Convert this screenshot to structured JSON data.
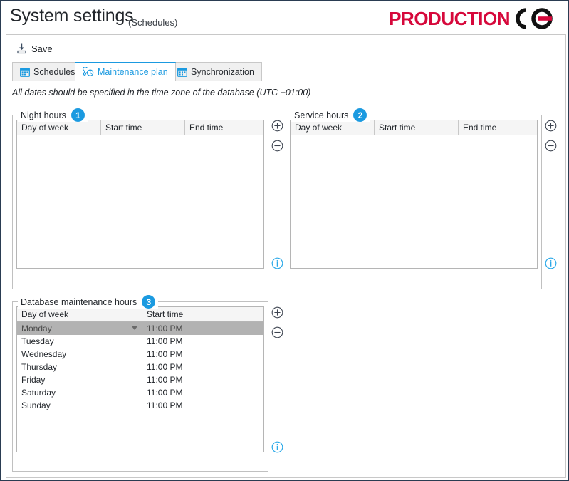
{
  "window": {
    "title": "System settings",
    "subtitle": "(Schedules)",
    "accent_blue": "#1b9ae0",
    "brand_red": "#d6083b",
    "frame_color": "#2a3c52"
  },
  "logo": {
    "text": "PRODUCTION",
    "mark_name": "interlocking-rings-logo-icon"
  },
  "toolbar": {
    "save_label": "Save",
    "save_icon": "save-icon"
  },
  "tabs": [
    {
      "label": "Schedules",
      "icon": "calendar-icon",
      "active": false
    },
    {
      "label": "Maintenance plan",
      "icon": "wrench-clock-icon",
      "active": true
    },
    {
      "label": "Synchronization",
      "icon": "calendar-icon",
      "active": false
    }
  ],
  "note": "All dates should be specified in the time zone of the database (UTC +01:00)",
  "sections": {
    "night_hours": {
      "label": "Night hours",
      "badge": "1",
      "columns": [
        "Day of week",
        "Start time",
        "End time"
      ],
      "rows": []
    },
    "service_hours": {
      "label": "Service hours",
      "badge": "2",
      "columns": [
        "Day of week",
        "Start time",
        "End time"
      ],
      "rows": []
    },
    "database_maintenance_hours": {
      "label": "Database maintenance hours",
      "badge": "3",
      "columns": [
        "Day of week",
        "Start time"
      ],
      "rows": [
        {
          "day": "Monday",
          "start": "11:00 PM",
          "selected": true
        },
        {
          "day": "Tuesday",
          "start": "11:00 PM",
          "selected": false
        },
        {
          "day": "Wednesday",
          "start": "11:00 PM",
          "selected": false
        },
        {
          "day": "Thursday",
          "start": "11:00 PM",
          "selected": false
        },
        {
          "day": "Friday",
          "start": "11:00 PM",
          "selected": false
        },
        {
          "day": "Saturday",
          "start": "11:00 PM",
          "selected": false
        },
        {
          "day": "Sunday",
          "start": "11:00 PM",
          "selected": false
        }
      ]
    }
  },
  "actions": {
    "add_icon": "circle-plus-icon",
    "remove_icon": "circle-minus-icon",
    "info_icon": "info-circle-icon"
  }
}
